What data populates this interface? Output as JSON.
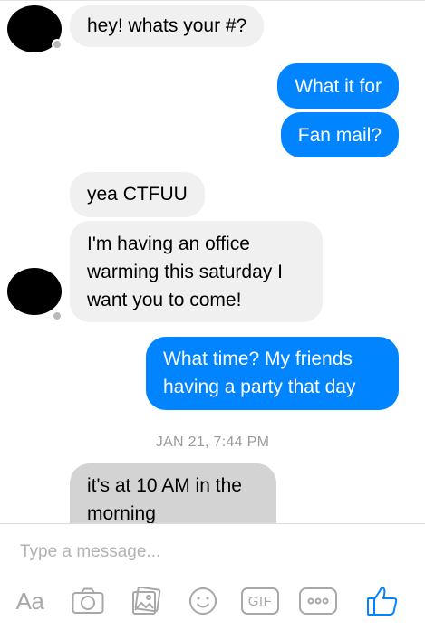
{
  "messages": [
    {
      "direction": "incoming",
      "text": "hey! whats your #?"
    },
    {
      "direction": "outgoing",
      "text": "What it for"
    },
    {
      "direction": "outgoing",
      "text": "Fan mail?"
    },
    {
      "direction": "incoming",
      "text": "yea CTFUU"
    },
    {
      "direction": "incoming",
      "lines": [
        "I'm having an office",
        "warming this saturday I",
        "want you to come!"
      ]
    },
    {
      "direction": "outgoing",
      "lines": [
        "What time? My friends",
        "having a party that day"
      ]
    },
    {
      "direction": "incoming",
      "lines": [
        "it's at 10 AM in the",
        "morning"
      ],
      "status": "sending"
    }
  ],
  "timestamp": "JAN 21, 7:44 PM",
  "composer": {
    "placeholder": "Type a message...",
    "toolbar": [
      {
        "icon": "text-format-icon",
        "label": "Aa"
      },
      {
        "icon": "camera-icon"
      },
      {
        "icon": "gallery-icon"
      },
      {
        "icon": "emoji-icon"
      },
      {
        "icon": "gif-icon",
        "label": "GIF"
      },
      {
        "icon": "more-options-icon"
      },
      {
        "icon": "thumbs-up-icon"
      }
    ]
  },
  "colors": {
    "outgoing_bubble": "#0084ff",
    "incoming_bubble": "#f0f0f0",
    "pending_bubble": "#d3d3d3",
    "like_icon": "#0084ff",
    "toolbar_icons": "#a8a8a8"
  }
}
